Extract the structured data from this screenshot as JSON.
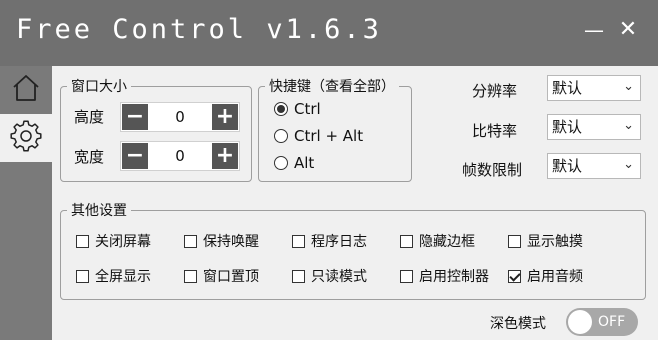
{
  "window": {
    "title": "Free Control v1.6.3",
    "minimize_glyph": "—",
    "close_glyph": "✕"
  },
  "sidebar": {
    "items": [
      {
        "name": "home",
        "icon": "home-icon"
      },
      {
        "name": "settings",
        "icon": "gear-icon"
      }
    ]
  },
  "window_size": {
    "legend": "窗口大小",
    "height_label": "高度",
    "height_value": "0",
    "width_label": "宽度",
    "width_value": "0",
    "minus_glyph": "−",
    "plus_glyph": "+"
  },
  "shortcuts": {
    "legend": "快捷键（查看全部）",
    "options": [
      "Ctrl",
      "Ctrl + Alt",
      "Alt"
    ],
    "selected": "Ctrl"
  },
  "stream": {
    "resolution_label": "分辨率",
    "resolution_value": "默认",
    "bitrate_label": "比特率",
    "bitrate_value": "默认",
    "fps_label": "帧数限制",
    "fps_value": "默认"
  },
  "other": {
    "legend": "其他设置",
    "options": [
      {
        "label": "关闭屏幕",
        "checked": false
      },
      {
        "label": "保持唤醒",
        "checked": false
      },
      {
        "label": "程序日志",
        "checked": false
      },
      {
        "label": "隐藏边框",
        "checked": false
      },
      {
        "label": "显示触摸",
        "checked": false
      },
      {
        "label": "全屏显示",
        "checked": false
      },
      {
        "label": "窗口置顶",
        "checked": false
      },
      {
        "label": "只读模式",
        "checked": false
      },
      {
        "label": "启用控制器",
        "checked": false
      },
      {
        "label": "启用音频",
        "checked": true
      }
    ]
  },
  "dark_mode": {
    "label": "深色模式",
    "state_text": "OFF",
    "enabled": false
  },
  "colors": {
    "titlebar": "#707070",
    "sidebar": "#7a7a7a",
    "background": "#f0f0f0",
    "stepper_button": "#555555"
  }
}
